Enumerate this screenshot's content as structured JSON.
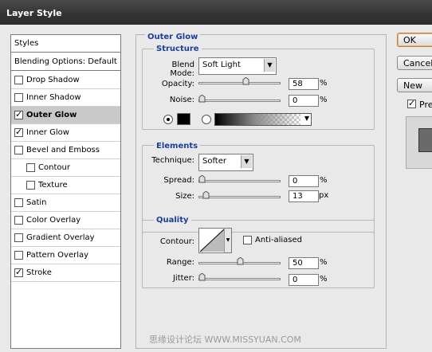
{
  "window": {
    "title": "Layer Style"
  },
  "styles_list": {
    "header": "Styles",
    "blending": "Blending Options: Default",
    "items": [
      {
        "label": "Drop Shadow",
        "checked": false,
        "selected": false,
        "indent": false
      },
      {
        "label": "Inner Shadow",
        "checked": false,
        "selected": false,
        "indent": false
      },
      {
        "label": "Outer Glow",
        "checked": true,
        "selected": true,
        "indent": false
      },
      {
        "label": "Inner Glow",
        "checked": true,
        "selected": false,
        "indent": false
      },
      {
        "label": "Bevel and Emboss",
        "checked": false,
        "selected": false,
        "indent": false
      },
      {
        "label": "Contour",
        "checked": false,
        "selected": false,
        "indent": true
      },
      {
        "label": "Texture",
        "checked": false,
        "selected": false,
        "indent": true
      },
      {
        "label": "Satin",
        "checked": false,
        "selected": false,
        "indent": false
      },
      {
        "label": "Color Overlay",
        "checked": false,
        "selected": false,
        "indent": false
      },
      {
        "label": "Gradient Overlay",
        "checked": false,
        "selected": false,
        "indent": false
      },
      {
        "label": "Pattern Overlay",
        "checked": false,
        "selected": false,
        "indent": false
      },
      {
        "label": "Stroke",
        "checked": true,
        "selected": false,
        "indent": false
      }
    ]
  },
  "outer_glow": {
    "title": "Outer Glow",
    "structure": {
      "title": "Structure",
      "blend_mode_label": "Blend Mode:",
      "blend_mode": "Soft Light",
      "opacity_label": "Opacity:",
      "opacity": "58",
      "opacity_level": 0.58,
      "noise_label": "Noise:",
      "noise": "0",
      "noise_level": 0,
      "percent": "%",
      "glow_color": "#000000",
      "color_mode": "solid"
    },
    "elements": {
      "title": "Elements",
      "technique_label": "Technique:",
      "technique": "Softer",
      "spread_label": "Spread:",
      "spread": "0",
      "spread_level": 0,
      "size_label": "Size:",
      "size": "13",
      "size_level": 0.05,
      "percent": "%",
      "px": "px"
    },
    "quality": {
      "title": "Quality",
      "contour_label": "Contour:",
      "anti_aliased_label": "Anti-aliased",
      "anti_aliased": false,
      "range_label": "Range:",
      "range": "50",
      "range_level": 0.5,
      "jitter_label": "Jitter:",
      "jitter": "0",
      "jitter_level": 0,
      "percent": "%"
    }
  },
  "buttons": {
    "ok": "OK",
    "cancel": "Cancel",
    "new_style": "New Style...",
    "preview": "Preview",
    "preview_checked": true
  },
  "watermark": "思缘设计论坛  WWW.MISSYUAN.COM"
}
